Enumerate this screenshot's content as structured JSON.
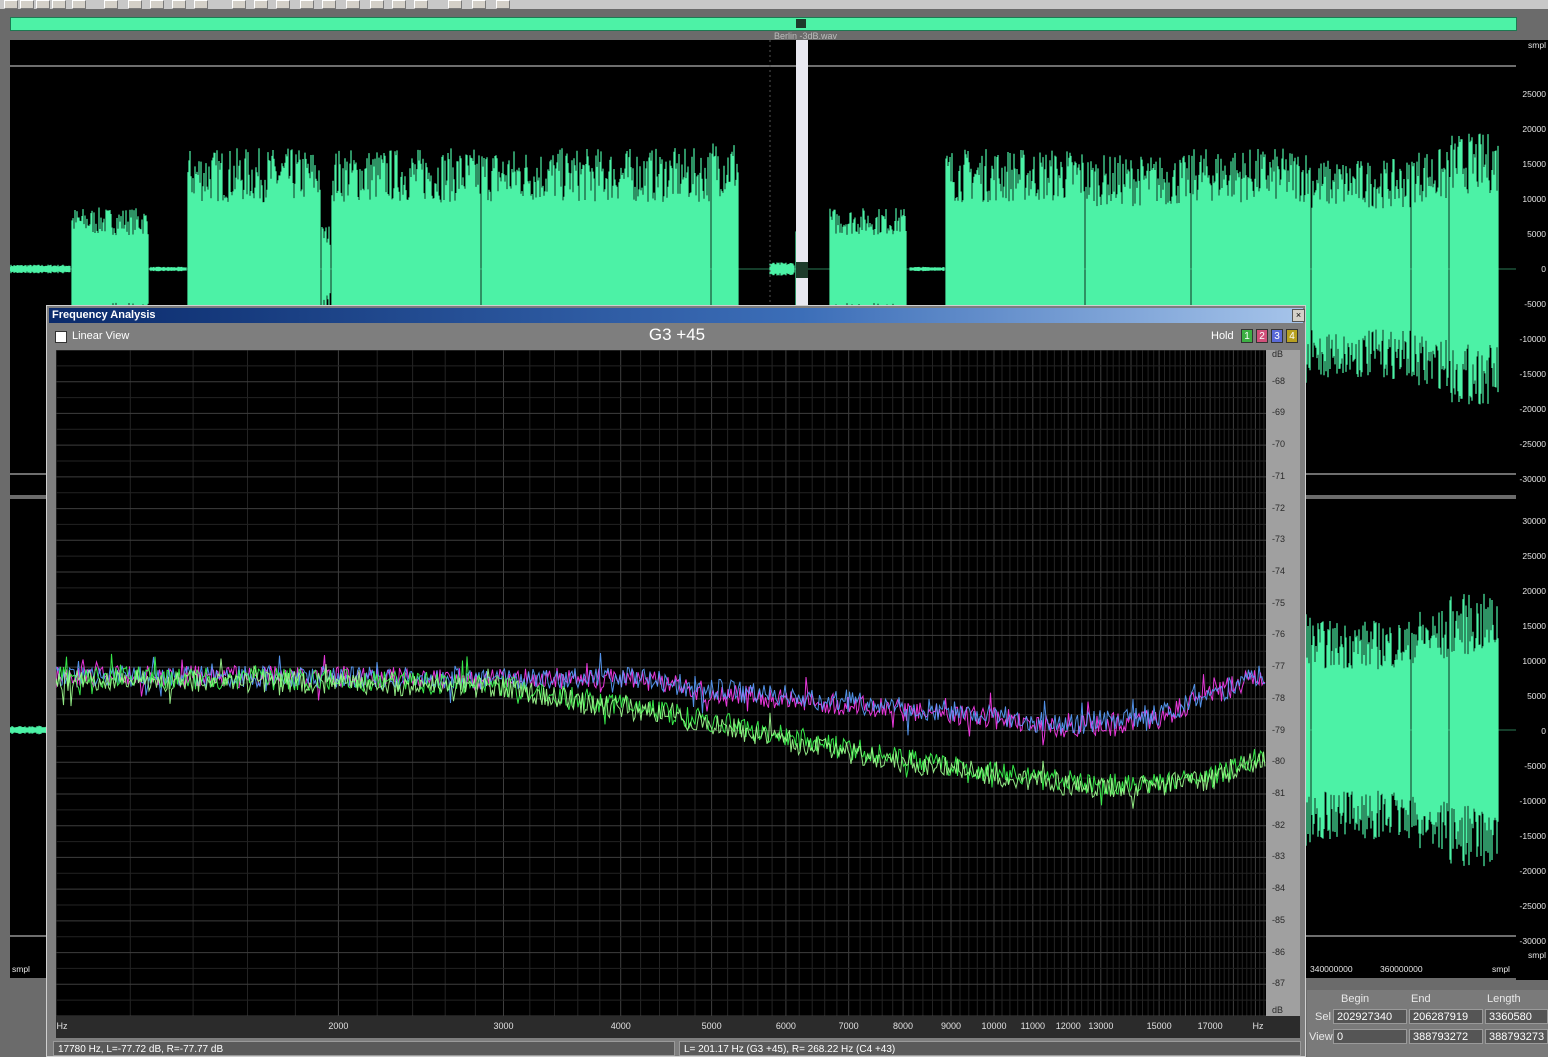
{
  "editor": {
    "filename": "Berlin -3dB.wav",
    "right_ticks": [
      "smpl",
      "25000",
      "20000",
      "15000",
      "10000",
      "5000",
      "0",
      "-5000",
      "-10000",
      "-15000",
      "-20000",
      "-25000",
      "-30000",
      "30000",
      "25000",
      "20000",
      "15000",
      "10000",
      "5000",
      "0",
      "-5000",
      "-10000",
      "-15000",
      "-20000",
      "-25000",
      "-30000",
      "smpl"
    ],
    "bottom_left": "smpl",
    "bottom_right": "smpl",
    "bottom_ticks": [
      "340000000",
      "360000000"
    ],
    "colors": {
      "waveform": "#4df2a6",
      "background": "#000000"
    }
  },
  "selection": {
    "headers": {
      "begin": "Begin",
      "end": "End",
      "length": "Length"
    },
    "sel_label": "Sel",
    "view_label": "View",
    "sel": {
      "begin": "202927340",
      "end": "206287919",
      "length": "3360580"
    },
    "view": {
      "begin": "0",
      "end": "388793272",
      "length": "388793273"
    }
  },
  "dialog": {
    "title": "Frequency Analysis",
    "close": "×",
    "linear_view": "Linear View",
    "note": "G3 +45",
    "hold": "Hold",
    "hold_buttons": [
      {
        "label": "1",
        "color": "#3cb043"
      },
      {
        "label": "2",
        "color": "#d0507a"
      },
      {
        "label": "3",
        "color": "#5a6ad8"
      },
      {
        "label": "4",
        "color": "#b8a020"
      }
    ],
    "status_left": "17780 Hz, L=-77.72 dB, R=-77.77 dB",
    "status_right": "L= 201.17 Hz (G3 +45), R= 268.22 Hz (C4 +43)"
  },
  "chart_data": {
    "type": "line",
    "x_unit_label": "Hz",
    "y_unit_label": "dB",
    "x_ticks": [
      "2000",
      "3000",
      "4000",
      "5000",
      "6000",
      "7000",
      "8000",
      "9000",
      "10000",
      "11000",
      "12000",
      "13000",
      "15000",
      "17000"
    ],
    "ylim": [
      -88,
      -67
    ],
    "y_ticks": [
      "-68",
      "-69",
      "-70",
      "-71",
      "-72",
      "-73",
      "-74",
      "-75",
      "-76",
      "-77",
      "-78",
      "-79",
      "-80",
      "-81",
      "-82",
      "-83",
      "-84",
      "-85",
      "-86",
      "-87"
    ],
    "grid": true,
    "series": [
      {
        "color": "#ff3cf0",
        "x": [
          1000,
          2000,
          3000,
          4000,
          5000,
          6000,
          7000,
          8000,
          9000,
          10000,
          11000,
          12000,
          13000,
          15000,
          17000,
          19000
        ],
        "values": [
          -77.3,
          -77.3,
          -77.4,
          -77.3,
          -77.8,
          -78.0,
          -78.2,
          -78.4,
          -78.5,
          -78.6,
          -78.8,
          -78.9,
          -78.8,
          -78.6,
          -77.9,
          -77.3
        ]
      },
      {
        "color": "#5aa0ff",
        "x": [
          1000,
          2000,
          3000,
          4000,
          5000,
          6000,
          7000,
          8000,
          9000,
          10000,
          11000,
          12000,
          13000,
          15000,
          17000,
          19000
        ],
        "values": [
          -77.3,
          -77.3,
          -77.4,
          -77.3,
          -77.7,
          -77.9,
          -78.1,
          -78.3,
          -78.4,
          -78.5,
          -78.7,
          -78.8,
          -78.7,
          -78.5,
          -77.9,
          -77.3
        ]
      },
      {
        "color": "#3cff50",
        "x": [
          1000,
          2000,
          3000,
          4000,
          5000,
          6000,
          7000,
          8000,
          9000,
          10000,
          11000,
          12000,
          13000,
          15000,
          17000,
          19000
        ],
        "values": [
          -77.3,
          -77.4,
          -77.6,
          -78.2,
          -78.7,
          -79.2,
          -79.6,
          -79.9,
          -80.1,
          -80.3,
          -80.5,
          -80.6,
          -80.7,
          -80.6,
          -80.5,
          -79.9
        ]
      },
      {
        "color": "#a0ff90",
        "x": [
          1000,
          2000,
          3000,
          4000,
          5000,
          6000,
          7000,
          8000,
          9000,
          10000,
          11000,
          12000,
          13000,
          15000,
          17000,
          19000
        ],
        "values": [
          -77.4,
          -77.5,
          -77.7,
          -78.3,
          -78.8,
          -79.3,
          -79.7,
          -80.0,
          -80.2,
          -80.4,
          -80.6,
          -80.7,
          -80.8,
          -80.7,
          -80.6,
          -80.0
        ]
      }
    ]
  }
}
